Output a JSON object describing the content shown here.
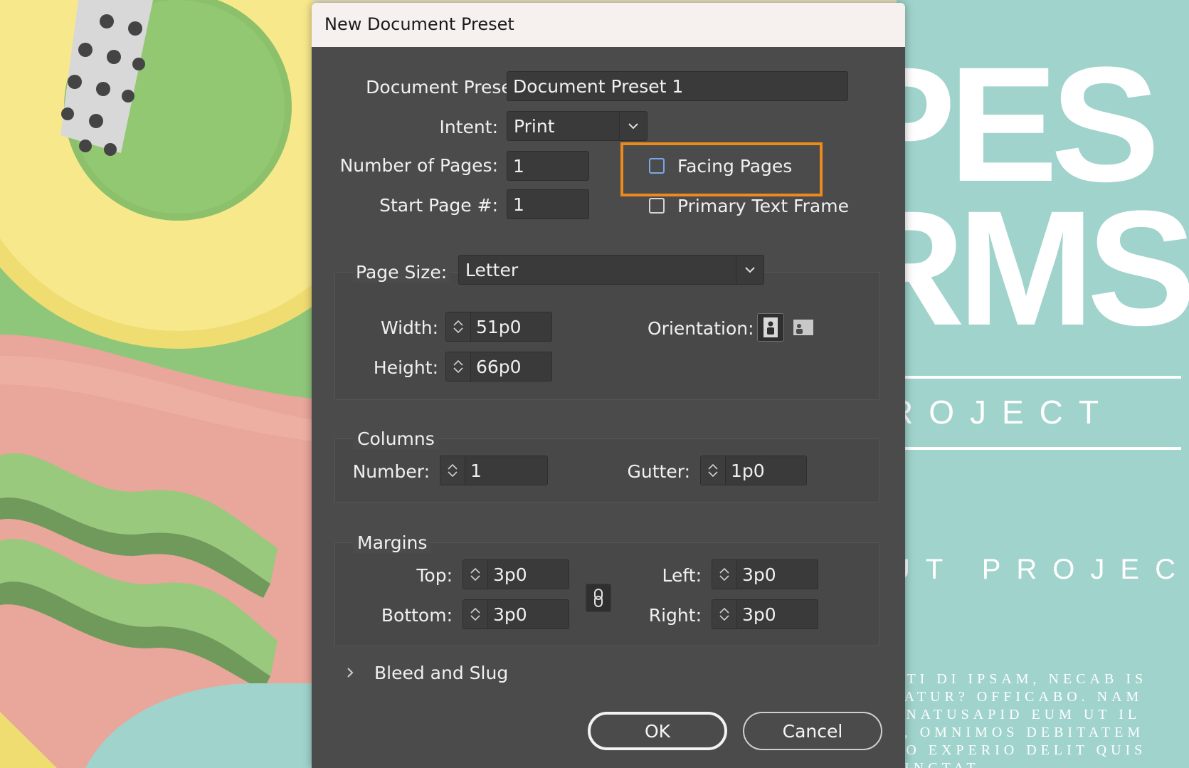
{
  "dialog": {
    "title": "New Document Preset",
    "document_preset": {
      "label": "Document Preset:",
      "value": "Document Preset 1"
    },
    "intent": {
      "label": "Intent:",
      "value": "Print"
    },
    "number_of_pages": {
      "label": "Number of Pages:",
      "value": "1"
    },
    "start_page": {
      "label": "Start Page #:",
      "value": "1"
    },
    "facing_pages": {
      "label": "Facing Pages",
      "checked": false
    },
    "primary_text_frame": {
      "label": "Primary Text Frame",
      "checked": false
    },
    "page_size": {
      "label": "Page Size:",
      "value": "Letter",
      "width_label": "Width:",
      "width": "51p0",
      "height_label": "Height:",
      "height": "66p0",
      "orientation_label": "Orientation:",
      "orientation_icons": [
        "portrait-icon",
        "landscape-icon"
      ],
      "orientation_selected": "portrait"
    },
    "columns": {
      "title": "Columns",
      "number_label": "Number:",
      "number": "1",
      "gutter_label": "Gutter:",
      "gutter": "1p0"
    },
    "margins": {
      "title": "Margins",
      "top_label": "Top:",
      "top": "3p0",
      "bottom_label": "Bottom:",
      "bottom": "3p0",
      "left_label": "Left:",
      "left": "3p0",
      "right_label": "Right:",
      "right": "3p0",
      "link_icon": "chain-link-icon"
    },
    "bleed_and_slug": {
      "label": "Bleed and Slug",
      "expanded": false
    },
    "buttons": {
      "ok": "OK",
      "cancel": "Cancel"
    }
  },
  "background_poster": {
    "line1": "PES",
    "line2": "RMS",
    "line3": "ROJECT",
    "line4": "UT PROJECT",
    "paragraph": "NTI DI IPSAM, NECAB IS\nTATUR? OFFICABO. NAM\nRNATUSAPID EUM UT IL\nT, OMNIMOS DEBITATEM\nRO EXPERIO DELIT QUIS\nSINCTAT"
  },
  "colors": {
    "dialog_bg": "#4b4b4b",
    "titlebar_bg": "#f6f0ef",
    "highlight": "#ec8a1e",
    "poster_bg": "#9fd3cc"
  }
}
